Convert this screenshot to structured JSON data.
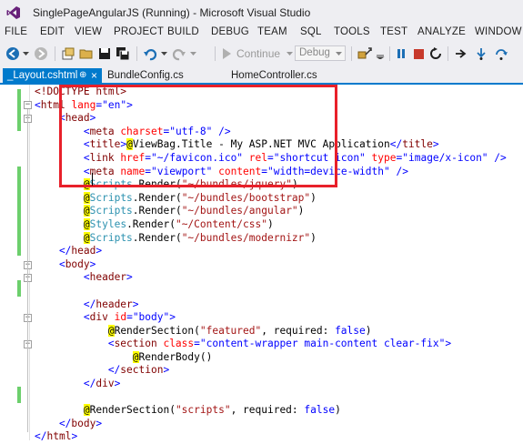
{
  "window": {
    "title": "SinglePageAngularJS (Running) - Microsoft Visual Studio"
  },
  "menu": [
    "FILE",
    "EDIT",
    "VIEW",
    "PROJECT",
    "BUILD",
    "DEBUG",
    "TEAM",
    "SQL",
    "TOOLS",
    "TEST",
    "ANALYZE",
    "WINDOW"
  ],
  "toolbar": {
    "continue_label": "Continue",
    "config_value": "Debug"
  },
  "tabs": [
    {
      "label": "_Layout.cshtml",
      "active": true,
      "pin": "⊕",
      "close": "×"
    },
    {
      "label": "BundleConfig.cs",
      "active": false
    },
    {
      "label": "HomeController.cs",
      "active": false
    }
  ],
  "colors": {
    "accent": "#007acc",
    "highlight_box": "#e8202a",
    "razor_marker": "#ffff00"
  },
  "code_lines": [
    [
      {
        "t": "<!DOCTYPE html>",
        "c": "tag"
      }
    ],
    [
      {
        "t": "<",
        "c": "val"
      },
      {
        "t": "html",
        "c": "tag"
      },
      {
        "t": " lang",
        "c": "attr"
      },
      {
        "t": "=",
        "c": "val"
      },
      {
        "t": "\"en\"",
        "c": "val"
      },
      {
        "t": ">",
        "c": "val"
      }
    ],
    [
      {
        "t": "    <",
        "c": "val"
      },
      {
        "t": "head",
        "c": "tag"
      },
      {
        "t": ">",
        "c": "val"
      }
    ],
    [
      {
        "t": "        <",
        "c": "val"
      },
      {
        "t": "meta",
        "c": "tag"
      },
      {
        "t": " charset",
        "c": "attr"
      },
      {
        "t": "=",
        "c": "val"
      },
      {
        "t": "\"utf-8\"",
        "c": "val"
      },
      {
        "t": " />",
        "c": "val"
      }
    ],
    [
      {
        "t": "        <",
        "c": "val"
      },
      {
        "t": "title",
        "c": "tag"
      },
      {
        "t": ">",
        "c": "val"
      },
      {
        "t": "@",
        "c": "razor"
      },
      {
        "t": "ViewBag.Title - My ASP.NET MVC Application",
        "c": "txt"
      },
      {
        "t": "</",
        "c": "val"
      },
      {
        "t": "title",
        "c": "tag"
      },
      {
        "t": ">",
        "c": "val"
      }
    ],
    [
      {
        "t": "        <",
        "c": "val"
      },
      {
        "t": "link",
        "c": "tag"
      },
      {
        "t": " href",
        "c": "attr"
      },
      {
        "t": "=",
        "c": "val"
      },
      {
        "t": "\"~/favicon.ico\"",
        "c": "val"
      },
      {
        "t": " rel",
        "c": "attr"
      },
      {
        "t": "=",
        "c": "val"
      },
      {
        "t": "\"shortcut icon\"",
        "c": "val"
      },
      {
        "t": " type",
        "c": "attr"
      },
      {
        "t": "=",
        "c": "val"
      },
      {
        "t": "\"image/x-icon\"",
        "c": "val"
      },
      {
        "t": " />",
        "c": "val"
      }
    ],
    [
      {
        "t": "        <",
        "c": "val"
      },
      {
        "t": "meta",
        "c": "tag"
      },
      {
        "t": " name",
        "c": "attr"
      },
      {
        "t": "=",
        "c": "val"
      },
      {
        "t": "\"viewport\"",
        "c": "val"
      },
      {
        "t": " content",
        "c": "attr"
      },
      {
        "t": "=",
        "c": "val"
      },
      {
        "t": "\"width=device-width\"",
        "c": "val"
      },
      {
        "t": " />",
        "c": "val"
      }
    ],
    [
      {
        "t": "        ",
        "c": "txt"
      },
      {
        "t": "@",
        "c": "razor"
      },
      {
        "t": "Scripts",
        "c": "cls"
      },
      {
        "t": ".Render(",
        "c": "txt"
      },
      {
        "t": "\"~/bundles/jquery\"",
        "c": "str"
      },
      {
        "t": ")",
        "c": "txt"
      }
    ],
    [
      {
        "t": "        ",
        "c": "txt"
      },
      {
        "t": "@",
        "c": "razor"
      },
      {
        "t": "Scripts",
        "c": "cls"
      },
      {
        "t": ".Render(",
        "c": "txt"
      },
      {
        "t": "\"~/bundles/bootstrap\"",
        "c": "str"
      },
      {
        "t": ")",
        "c": "txt"
      }
    ],
    [
      {
        "t": "        ",
        "c": "txt"
      },
      {
        "t": "@",
        "c": "razor"
      },
      {
        "t": "Scripts",
        "c": "cls"
      },
      {
        "t": ".Render(",
        "c": "txt"
      },
      {
        "t": "\"~/bundles/angular\"",
        "c": "str"
      },
      {
        "t": ")",
        "c": "txt"
      }
    ],
    [
      {
        "t": "        ",
        "c": "txt"
      },
      {
        "t": "@",
        "c": "razor"
      },
      {
        "t": "Styles",
        "c": "cls"
      },
      {
        "t": ".Render(",
        "c": "txt"
      },
      {
        "t": "\"~/Content/css\"",
        "c": "str"
      },
      {
        "t": ")",
        "c": "txt"
      }
    ],
    [
      {
        "t": "        ",
        "c": "txt"
      },
      {
        "t": "@",
        "c": "razor"
      },
      {
        "t": "Scripts",
        "c": "cls"
      },
      {
        "t": ".Render(",
        "c": "txt"
      },
      {
        "t": "\"~/bundles/modernizr\"",
        "c": "str"
      },
      {
        "t": ")",
        "c": "txt"
      }
    ],
    [
      {
        "t": "    </",
        "c": "val"
      },
      {
        "t": "head",
        "c": "tag"
      },
      {
        "t": ">",
        "c": "val"
      }
    ],
    [
      {
        "t": "    <",
        "c": "val"
      },
      {
        "t": "body",
        "c": "tag"
      },
      {
        "t": ">",
        "c": "val"
      }
    ],
    [
      {
        "t": "        <",
        "c": "val"
      },
      {
        "t": "header",
        "c": "tag"
      },
      {
        "t": ">",
        "c": "val"
      }
    ],
    [
      {
        "t": "",
        "c": "txt"
      }
    ],
    [
      {
        "t": "        </",
        "c": "val"
      },
      {
        "t": "header",
        "c": "tag"
      },
      {
        "t": ">",
        "c": "val"
      }
    ],
    [
      {
        "t": "        <",
        "c": "val"
      },
      {
        "t": "div",
        "c": "tag"
      },
      {
        "t": " id",
        "c": "attr"
      },
      {
        "t": "=",
        "c": "val"
      },
      {
        "t": "\"body\"",
        "c": "val"
      },
      {
        "t": ">",
        "c": "val"
      }
    ],
    [
      {
        "t": "            ",
        "c": "txt"
      },
      {
        "t": "@",
        "c": "razor"
      },
      {
        "t": "RenderSection(",
        "c": "txt"
      },
      {
        "t": "\"featured\"",
        "c": "str"
      },
      {
        "t": ", required: ",
        "c": "txt"
      },
      {
        "t": "false",
        "c": "kw"
      },
      {
        "t": ")",
        "c": "txt"
      }
    ],
    [
      {
        "t": "            <",
        "c": "val"
      },
      {
        "t": "section",
        "c": "tag"
      },
      {
        "t": " class",
        "c": "attr"
      },
      {
        "t": "=",
        "c": "val"
      },
      {
        "t": "\"content-wrapper main-content clear-fix\"",
        "c": "val"
      },
      {
        "t": ">",
        "c": "val"
      }
    ],
    [
      {
        "t": "                ",
        "c": "txt"
      },
      {
        "t": "@",
        "c": "razor"
      },
      {
        "t": "RenderBody()",
        "c": "txt"
      }
    ],
    [
      {
        "t": "            </",
        "c": "val"
      },
      {
        "t": "section",
        "c": "tag"
      },
      {
        "t": ">",
        "c": "val"
      }
    ],
    [
      {
        "t": "        </",
        "c": "val"
      },
      {
        "t": "div",
        "c": "tag"
      },
      {
        "t": ">",
        "c": "val"
      }
    ],
    [
      {
        "t": "",
        "c": "txt"
      }
    ],
    [
      {
        "t": "        ",
        "c": "txt"
      },
      {
        "t": "@",
        "c": "razor"
      },
      {
        "t": "RenderSection(",
        "c": "txt"
      },
      {
        "t": "\"scripts\"",
        "c": "str"
      },
      {
        "t": ", required: ",
        "c": "txt"
      },
      {
        "t": "false",
        "c": "kw"
      },
      {
        "t": ")",
        "c": "txt"
      }
    ],
    [
      {
        "t": "    </",
        "c": "val"
      },
      {
        "t": "body",
        "c": "tag"
      },
      {
        "t": ">",
        "c": "val"
      }
    ],
    [
      {
        "t": "</",
        "c": "val"
      },
      {
        "t": "html",
        "c": "tag"
      },
      {
        "t": ">",
        "c": "val"
      }
    ]
  ]
}
